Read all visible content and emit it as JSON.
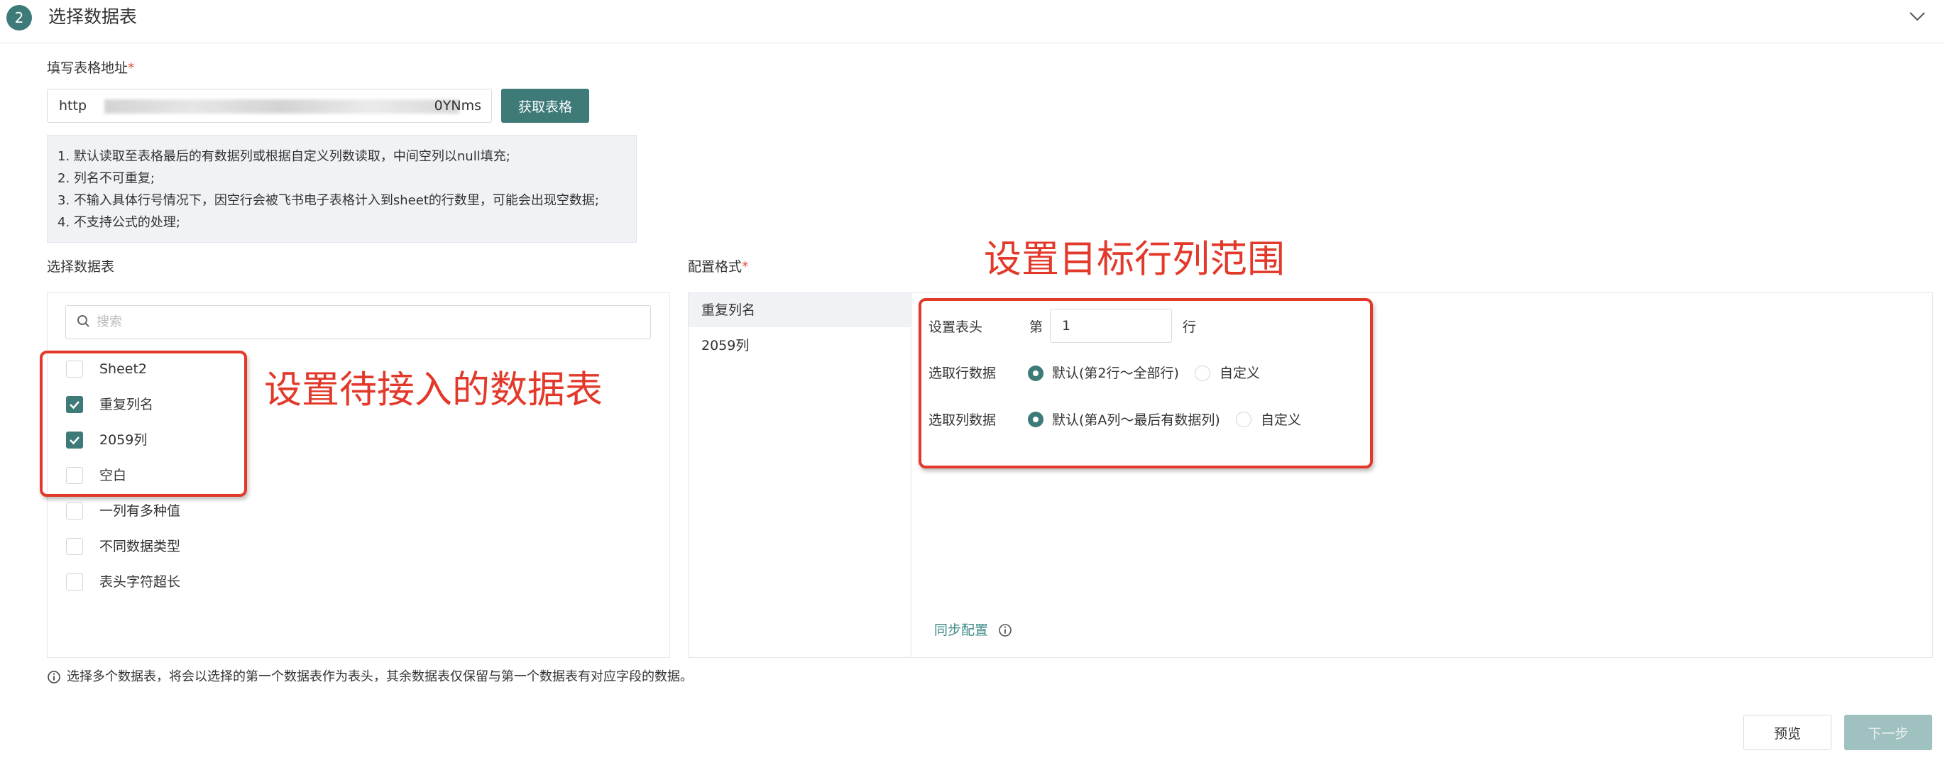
{
  "step": {
    "number": "2",
    "title": "选择数据表"
  },
  "url_field": {
    "label": "填写表格地址",
    "required_mark": "*",
    "value_start": "http",
    "value_end": "0YNms"
  },
  "fetch_button": "获取表格",
  "notice": [
    "1. 默认读取至表格最后的有数据列或根据自定义列数读取，中间空列以null填充;",
    "2. 列名不可重复;",
    "3. 不输入具体行号情况下，因空行会被飞书电子表格计入到sheet的行数里，可能会出现空数据;",
    "4. 不支持公式的处理;"
  ],
  "select_tables": {
    "label": "选择数据表",
    "search_placeholder": "搜索",
    "items": [
      {
        "label": "Sheet2",
        "checked": false
      },
      {
        "label": "重复列名",
        "checked": true
      },
      {
        "label": "2059列",
        "checked": true
      },
      {
        "label": "空白",
        "checked": false
      },
      {
        "label": "一列有多种值",
        "checked": false
      },
      {
        "label": "不同数据类型",
        "checked": false
      },
      {
        "label": "表头字符超长",
        "checked": false
      }
    ]
  },
  "config": {
    "label": "配置格式",
    "required_mark": "*",
    "sheets": [
      "重复列名",
      "2059列"
    ],
    "header": {
      "label": "设置表头",
      "prefix": "第",
      "value": "1",
      "suffix": "行"
    },
    "row_select": {
      "label": "选取行数据",
      "default": "默认(第2行～全部行)",
      "custom": "自定义",
      "selected": "default"
    },
    "col_select": {
      "label": "选取列数据",
      "default": "默认(第A列～最后有数据列)",
      "custom": "自定义",
      "selected": "default"
    },
    "sync_link": "同步配置"
  },
  "footer_note": "选择多个数据表，将会以选择的第一个数据表作为表头，其余数据表仅保留与第一个数据表有对应字段的数据。",
  "buttons": {
    "preview": "预览",
    "next": "下一步"
  },
  "annotations": {
    "left": "设置待接入的数据表",
    "right": "设置目标行列范围"
  },
  "colors": {
    "accent": "#3d7a78",
    "annotation": "#e2392b",
    "required": "#e04a3a"
  }
}
